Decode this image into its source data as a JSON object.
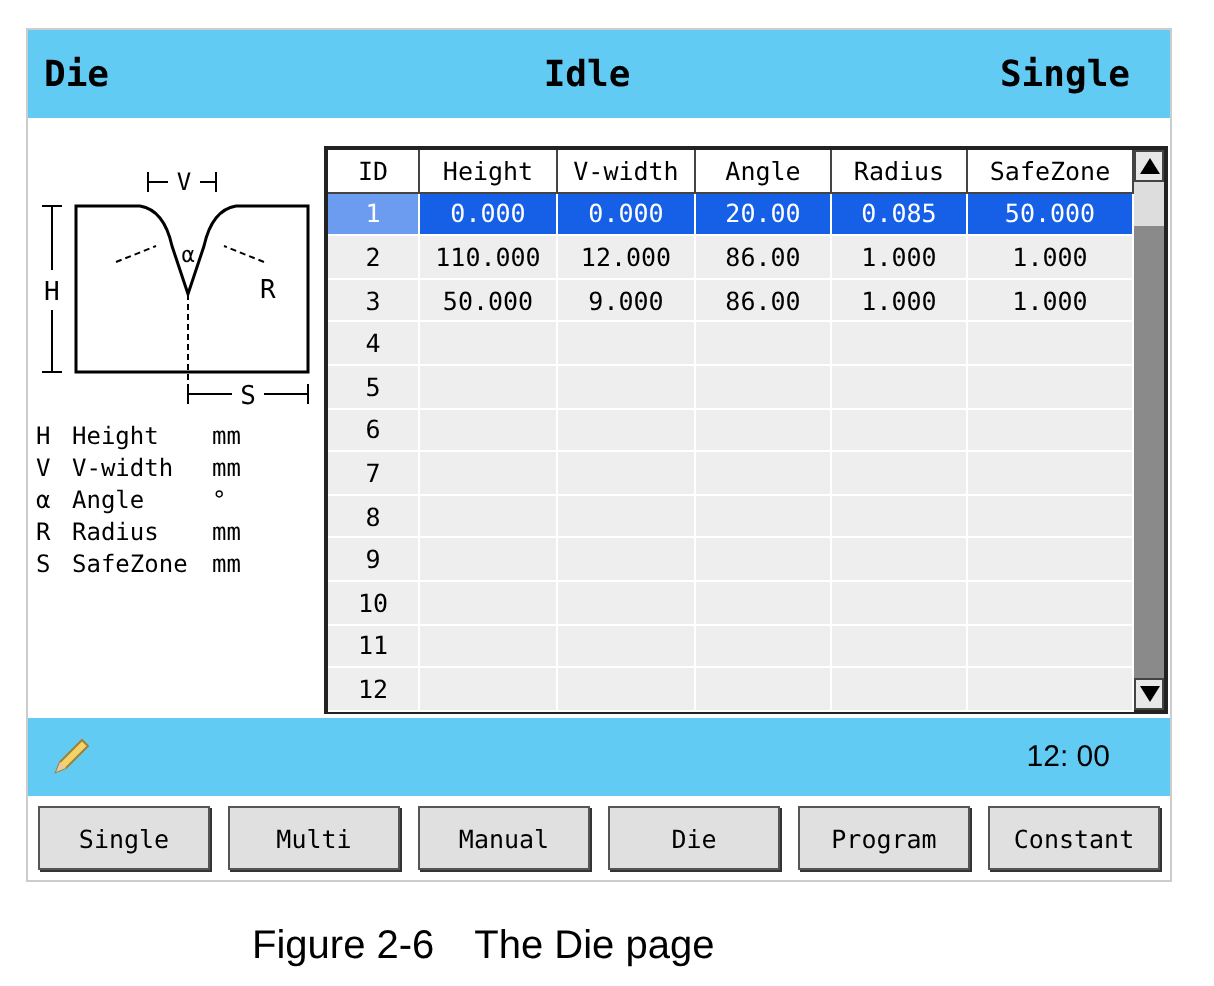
{
  "header": {
    "page": "Die",
    "status": "Idle",
    "mode": "Single"
  },
  "diagram": {
    "labels": [
      "V",
      "α",
      "R",
      "H",
      "S"
    ]
  },
  "legend": [
    {
      "symbol": "H",
      "name": "Height",
      "unit": "mm"
    },
    {
      "symbol": "V",
      "name": "V-width",
      "unit": "mm"
    },
    {
      "symbol": "α",
      "name": "Angle",
      "unit": "°"
    },
    {
      "symbol": "R",
      "name": "Radius",
      "unit": "mm"
    },
    {
      "symbol": "S",
      "name": "SafeZone",
      "unit": "mm"
    }
  ],
  "table": {
    "columns": [
      "ID",
      "Height",
      "V-width",
      "Angle",
      "Radius",
      "SafeZone"
    ],
    "rows": [
      {
        "cells": [
          "1",
          "0.000",
          "0.000",
          "20.00",
          "0.085",
          "50.000"
        ],
        "selected": true
      },
      {
        "cells": [
          "2",
          "110.000",
          "12.000",
          "86.00",
          "1.000",
          "1.000"
        ],
        "selected": false
      },
      {
        "cells": [
          "3",
          "50.000",
          "9.000",
          "86.00",
          "1.000",
          "1.000"
        ],
        "selected": false
      },
      {
        "cells": [
          "4"
        ],
        "selected": false
      },
      {
        "cells": [
          "5"
        ],
        "selected": false
      },
      {
        "cells": [
          "6"
        ],
        "selected": false
      },
      {
        "cells": [
          "7"
        ],
        "selected": false
      },
      {
        "cells": [
          "8"
        ],
        "selected": false
      },
      {
        "cells": [
          "9"
        ],
        "selected": false
      },
      {
        "cells": [
          "10"
        ],
        "selected": false
      },
      {
        "cells": [
          "11"
        ],
        "selected": false
      },
      {
        "cells": [
          "12"
        ],
        "selected": false
      }
    ]
  },
  "status_bar": {
    "time": "12: 00"
  },
  "nav_buttons": [
    "Single",
    "Multi",
    "Manual",
    "Die",
    "Program",
    "Constant"
  ],
  "caption": "Figure 2-6　The Die page"
}
